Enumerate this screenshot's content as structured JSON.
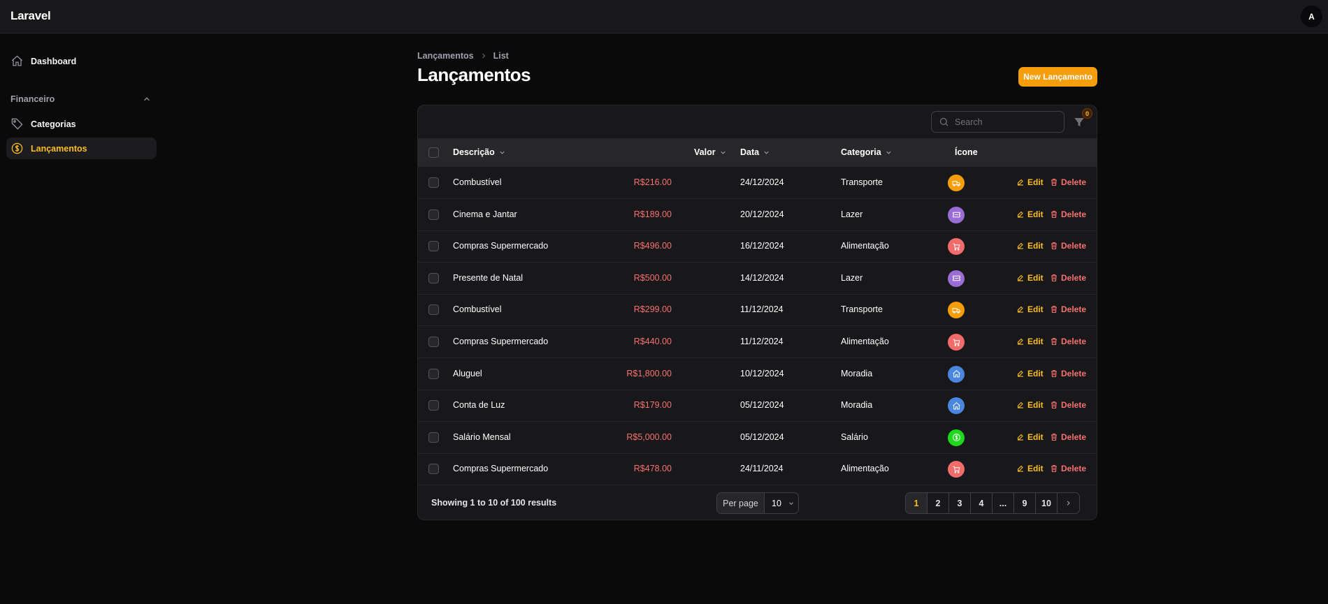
{
  "app": {
    "brand": "Laravel",
    "user_initial": "A"
  },
  "sidebar": {
    "dashboard": "Dashboard",
    "group_label": "Financeiro",
    "categorias": "Categorias",
    "lancamentos": "Lançamentos"
  },
  "breadcrumb": {
    "parent": "Lançamentos",
    "current": "List"
  },
  "page": {
    "title": "Lançamentos",
    "new_button": "New Lançamento"
  },
  "toolbar": {
    "search_placeholder": "Search",
    "filter_count": "0"
  },
  "table": {
    "headers": {
      "descricao": "Descrição",
      "valor": "Valor",
      "data": "Data",
      "categoria": "Categoria",
      "icone": "Ícone"
    },
    "action_edit": "Edit",
    "action_delete": "Delete",
    "rows": [
      {
        "descricao": "Combustível",
        "valor": "R$216.00",
        "data": "24/12/2024",
        "categoria": "Transporte",
        "icon": "truck-icon",
        "icon_color": "#f59e0b"
      },
      {
        "descricao": "Cinema e Jantar",
        "valor": "R$189.00",
        "data": "20/12/2024",
        "categoria": "Lazer",
        "icon": "ticket-icon",
        "icon_color": "#9a6cd6"
      },
      {
        "descricao": "Compras Supermercado",
        "valor": "R$496.00",
        "data": "16/12/2024",
        "categoria": "Alimentação",
        "icon": "cart-icon",
        "icon_color": "#f26b6b"
      },
      {
        "descricao": "Presente de Natal",
        "valor": "R$500.00",
        "data": "14/12/2024",
        "categoria": "Lazer",
        "icon": "ticket-icon",
        "icon_color": "#9a6cd6"
      },
      {
        "descricao": "Combustível",
        "valor": "R$299.00",
        "data": "11/12/2024",
        "categoria": "Transporte",
        "icon": "truck-icon",
        "icon_color": "#f59e0b"
      },
      {
        "descricao": "Compras Supermercado",
        "valor": "R$440.00",
        "data": "11/12/2024",
        "categoria": "Alimentação",
        "icon": "cart-icon",
        "icon_color": "#f26b6b"
      },
      {
        "descricao": "Aluguel",
        "valor": "R$1,800.00",
        "data": "10/12/2024",
        "categoria": "Moradia",
        "icon": "home-icon",
        "icon_color": "#4a86e0"
      },
      {
        "descricao": "Conta de Luz",
        "valor": "R$179.00",
        "data": "05/12/2024",
        "categoria": "Moradia",
        "icon": "home-icon",
        "icon_color": "#4a86e0"
      },
      {
        "descricao": "Salário Mensal",
        "valor": "R$5,000.00",
        "data": "05/12/2024",
        "categoria": "Salário",
        "icon": "dollar-icon",
        "icon_color": "#1ed81e"
      },
      {
        "descricao": "Compras Supermercado",
        "valor": "R$478.00",
        "data": "24/11/2024",
        "categoria": "Alimentação",
        "icon": "cart-icon",
        "icon_color": "#f26b6b"
      }
    ]
  },
  "footer": {
    "showing": "Showing 1 to 10 of 100 results",
    "per_page_label": "Per page",
    "per_page_value": "10",
    "pages": [
      "1",
      "2",
      "3",
      "4",
      "...",
      "9",
      "10"
    ],
    "current_page": "1"
  },
  "colors": {
    "accent": "#f59e0b",
    "danger": "#f87171",
    "background": "#0a0a0a",
    "surface": "#18181b"
  }
}
